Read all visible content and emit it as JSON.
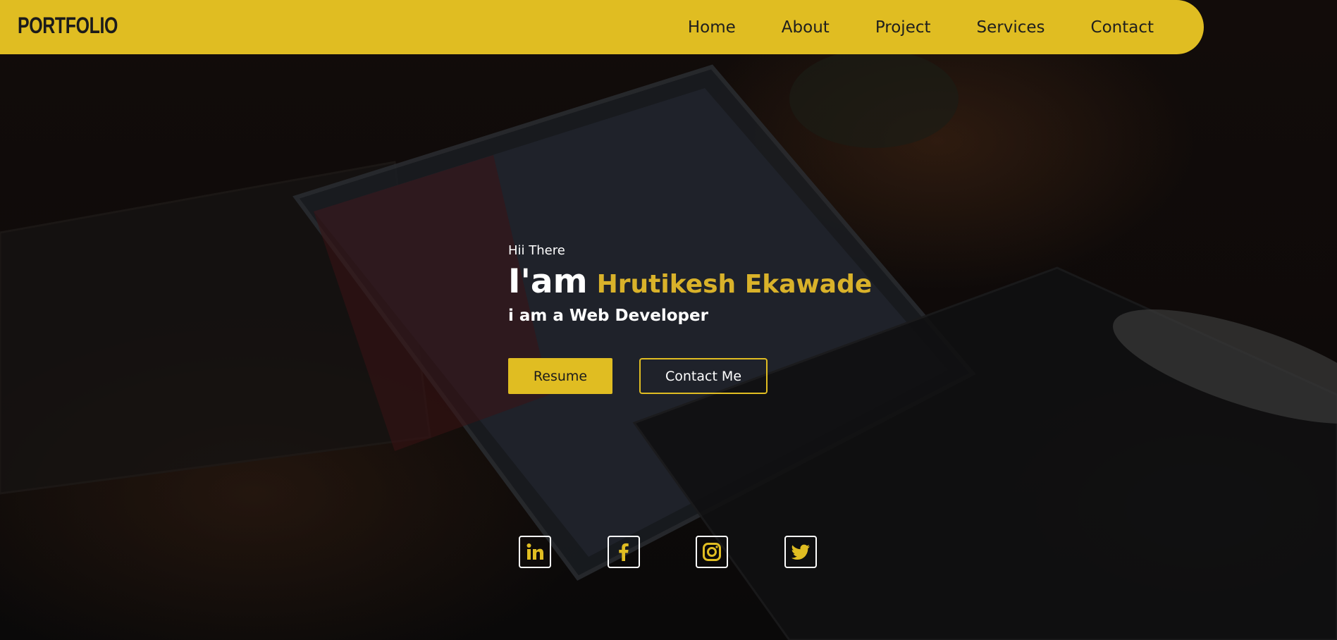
{
  "navbar": {
    "logo": "PORTFOLIO",
    "links": [
      "Home",
      "About",
      "Project",
      "Services",
      "Contact"
    ]
  },
  "hero": {
    "greeting": "Hii There",
    "iam": "I'am",
    "name": "Hrutikesh Ekawade",
    "role": "i am a Web Developer",
    "resume_label": "Resume",
    "contact_label": "Contact Me"
  },
  "socials": [
    "linkedin-icon",
    "facebook-icon",
    "instagram-icon",
    "twitter-icon"
  ],
  "colors": {
    "accent": "#e0bd22",
    "name": "#d9b22a",
    "background": "#0e0a09"
  }
}
